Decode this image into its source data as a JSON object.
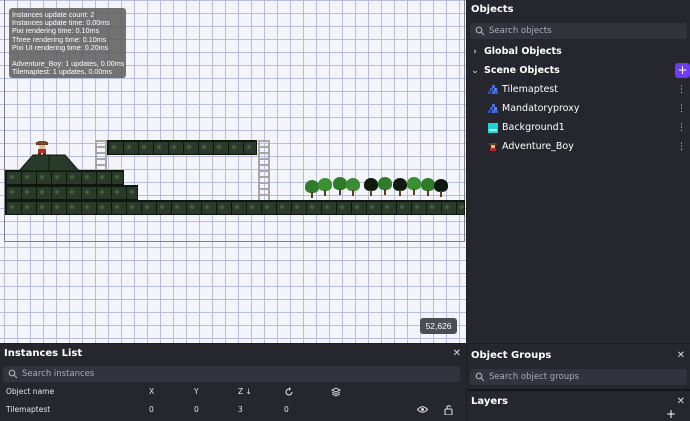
{
  "performance_overlay": {
    "lines": [
      "Instances update count: 2",
      "Instances update time: 0.00ms",
      "Pixi rendering time: 0.10ms",
      "Three rendering time: 0.10ms",
      "Pixi UI rendering time: 0.20ms",
      "",
      "Adventure_Boy: 1 updates, 0.00ms",
      "Tilemaptest: 1 updates, 0.00ms"
    ]
  },
  "canvas": {
    "coords": "52,626"
  },
  "objects_panel": {
    "title": "Objects",
    "search_placeholder": "Search objects",
    "global_label": "Global Objects",
    "scene_label": "Scene Objects",
    "add_symbol": "+",
    "items": [
      {
        "name": "Tilemaptest",
        "icon": "tilemap-icon"
      },
      {
        "name": "Mandatoryproxy",
        "icon": "tilemap-icon"
      },
      {
        "name": "Background1",
        "icon": "background-icon"
      },
      {
        "name": "Adventure_Boy",
        "icon": "sprite-icon"
      }
    ]
  },
  "instances_panel": {
    "title": "Instances List",
    "search_placeholder": "Search instances",
    "columns": {
      "name": "Object name",
      "x": "X",
      "y": "Y",
      "z": "Z ↓"
    },
    "rows": [
      {
        "name": "Tilemaptest",
        "x": "0",
        "y": "0",
        "z": "3",
        "angle": "0"
      }
    ]
  },
  "object_groups_panel": {
    "title": "Object Groups",
    "search_placeholder": "Search object groups"
  },
  "layers_panel": {
    "title": "Layers",
    "add_symbol": "+"
  },
  "colors": {
    "accent": "#6e3df2",
    "panel_bg": "#25262e",
    "canvas_bg": "#f4f5fb"
  }
}
